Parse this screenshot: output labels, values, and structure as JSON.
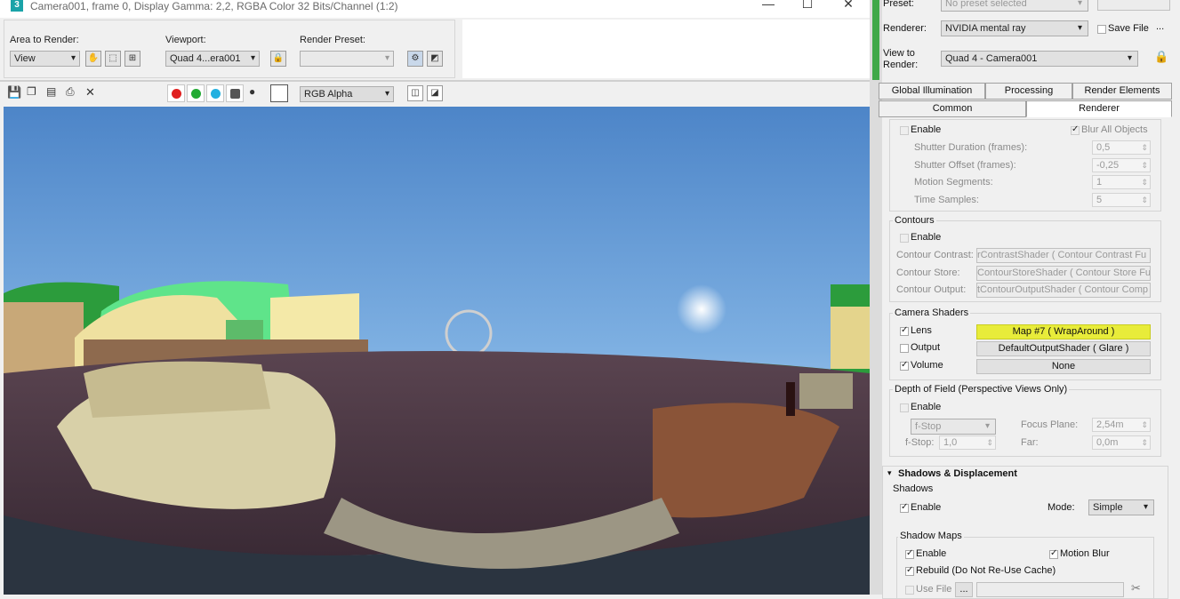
{
  "window": {
    "title": "Camera001, frame 0, Display Gamma: 2,2, RGBA Color 32 Bits/Channel (1:2)",
    "min": "—",
    "max": "☐",
    "close": "✕",
    "logo": "3"
  },
  "toolbar": {
    "area_label": "Area to Render:",
    "area_value": "View",
    "viewport_label": "Viewport:",
    "viewport_value": "Quad 4...era001",
    "preset_label": "Render Preset:",
    "preset_value": "",
    "channel_value": "RGB Alpha"
  },
  "panel": {
    "preset_label": "Preset:",
    "preset_value": "No preset selected",
    "renderer_label": "Renderer:",
    "renderer_value": "NVIDIA mental ray",
    "save_file": "Save File",
    "more": "...",
    "view_label": "View to\nRender:",
    "view_value": "Quad 4 - Camera001",
    "tabs": [
      "Global Illumination",
      "Processing",
      "Render Elements",
      "Common",
      "Renderer"
    ],
    "motion": {
      "enable": "Enable",
      "blur_all": "Blur All Objects",
      "rows": [
        {
          "label": "Shutter Duration (frames):",
          "value": "0,5"
        },
        {
          "label": "Shutter Offset (frames):",
          "value": "-0,25"
        },
        {
          "label": "Motion Segments:",
          "value": "1"
        },
        {
          "label": "Time Samples:",
          "value": "5"
        }
      ]
    },
    "contours": {
      "title": "Contours",
      "enable": "Enable",
      "rows": [
        {
          "label": "Contour Contrast:",
          "value": "rContrastShader  ( Contour Contrast Fu"
        },
        {
          "label": "Contour Store:",
          "value": "ContourStoreShader  ( Contour Store Fu"
        },
        {
          "label": "Contour Output:",
          "value": "tContourOutputShader  ( Contour Comp"
        }
      ]
    },
    "camera": {
      "title": "Camera Shaders",
      "rows": [
        {
          "label": "Lens",
          "value": "Map #7  ( WrapAround )"
        },
        {
          "label": "Output",
          "value": "DefaultOutputShader  ( Glare )"
        },
        {
          "label": "Volume",
          "value": "None"
        }
      ]
    },
    "dof": {
      "title": "Depth of Field (Perspective Views Only)",
      "enable": "Enable",
      "fstop_mode": "f-Stop",
      "focus_label": "Focus Plane:",
      "focus_value": "2,54m",
      "fstop_label": "f-Stop:",
      "fstop_value": "1,0",
      "far_label": "Far:",
      "far_value": "0,0m"
    },
    "shadows": {
      "header": "Shadows & Displacement",
      "title": "Shadows",
      "enable": "Enable",
      "mode_label": "Mode:",
      "mode_value": "Simple",
      "maps_title": "Shadow Maps",
      "maps_enable": "Enable",
      "motion_blur": "Motion Blur",
      "rebuild": "Rebuild (Do Not Re-Use Cache)",
      "use_file": "Use File",
      "dots": "..."
    }
  },
  "colors": {
    "highlight": "#e8ec3a",
    "accent": "#3fa848"
  }
}
